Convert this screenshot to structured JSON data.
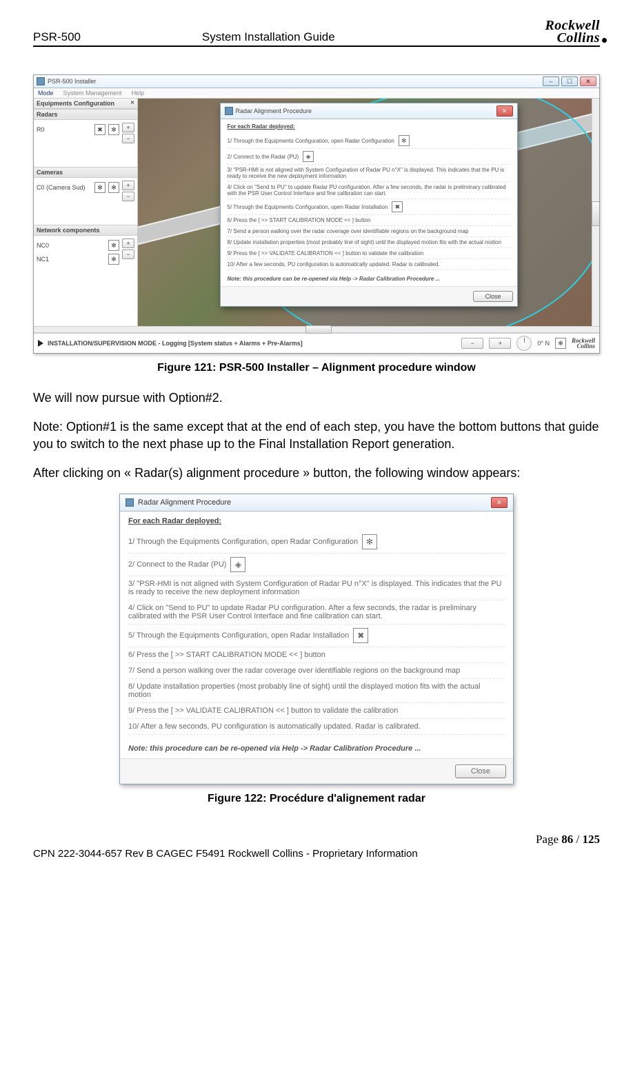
{
  "header": {
    "left": "PSR-500",
    "center": "System Installation Guide",
    "logo_top": "Rockwell",
    "logo_bottom": "Collins"
  },
  "installer": {
    "title": "PSR-500 Installer",
    "menu": [
      "Mode",
      "System Management",
      "Help"
    ],
    "panel_title": "Equipments Configuration",
    "sections": {
      "radars": {
        "title": "Radars",
        "items": [
          "R0"
        ]
      },
      "cameras": {
        "title": "Cameras",
        "items": [
          "C0 (Camera Sud)"
        ]
      },
      "network": {
        "title": "Network components",
        "items": [
          "NC0",
          "NC1"
        ]
      }
    },
    "status_text": "INSTALLATION/SUPERVISION MODE - Logging [System status + Alarms + Pre-Alarms]",
    "heading_deg": "0° N",
    "tiny_logo_top": "Rockwell",
    "tiny_logo_bottom": "Collins"
  },
  "dialog": {
    "title": "Radar Alignment Procedure",
    "heading": "For each Radar deployed:",
    "steps": [
      "1/ Through the Equipments Configuration, open Radar Configuration",
      "2/ Connect to the Radar (PU)",
      "3/ \"PSR-HMI is not aligned with System Configuration of Radar PU n°X\" is displayed. This indicates that the PU is ready to receive the new deployment information",
      "4/ Click on \"Send to PU\" to update Radar PU configuration. After a few seconds, the radar is preliminary calibrated with the PSR User Control Interface and fine calibration can start.",
      "5/ Through the Equipments Configuration, open Radar Installation",
      "6/ Press the [ >> START CALIBRATION MODE << ] button",
      "7/ Send a person walking over the radar coverage over identifiable regions on the background map",
      "8/ Update installation properties (most probably line of sight) until the displayed motion fits with the actual motion",
      "9/ Press the [ >> VALIDATE CALIBRATION << ] button to validate the calibration",
      "10/ After a few seconds, PU configuration is automatically updated. Radar is calibrated."
    ],
    "note": "Note: this procedure can be re-opened via Help -> Radar Calibration Procedure ...",
    "close": "Close"
  },
  "body": {
    "caption1": "Figure 121: PSR-500 Installer – Alignment procedure window",
    "p1": "We will now pursue with Option#2.",
    "p2": "Note: Option#1 is the same except that at the end of each step, you have the bottom buttons that guide you to switch to the next phase up to the Final Installation Report generation.",
    "p3": "After clicking on « Radar(s) alignment procedure » button, the following window appears:",
    "caption2": "Figure 122: Procédure d'alignement radar"
  },
  "footer": {
    "page_prefix": "Page ",
    "page_cur": "86",
    "page_sep": " / ",
    "page_total": "125",
    "line2": "CPN 222-3044-657 Rev B CAGEC F5491 Rockwell Collins - Proprietary Information"
  },
  "icons": {
    "gear": "✻",
    "tool": "✖",
    "wifi": "◈",
    "plus": "+",
    "minus": "−",
    "panel_x": "✕"
  }
}
